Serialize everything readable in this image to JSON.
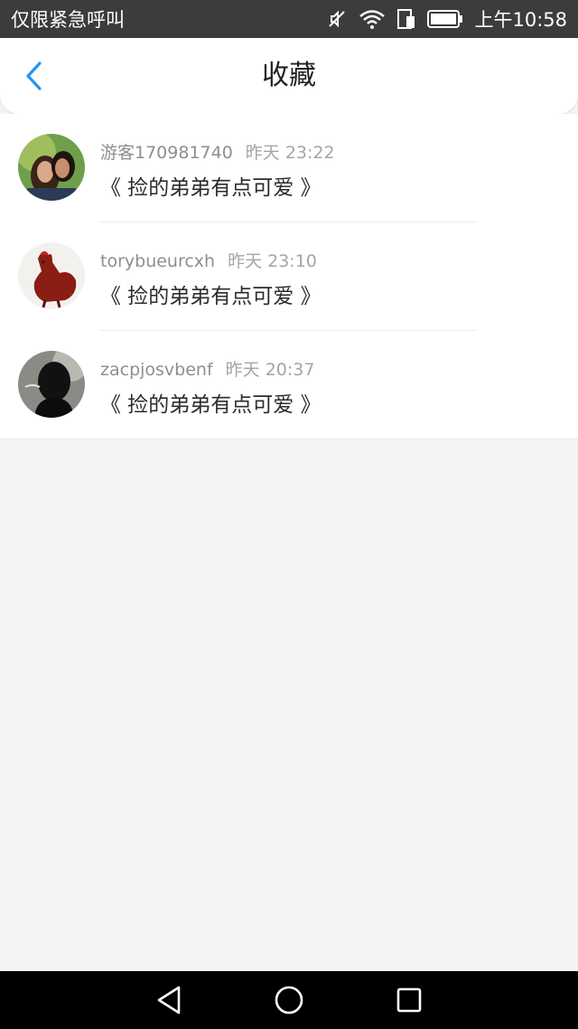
{
  "status_bar": {
    "carrier": "仅限紧急呼叫",
    "time": "上午10:58",
    "icons": [
      "mute-icon",
      "wifi-icon",
      "sim-icon",
      "battery-icon"
    ]
  },
  "header": {
    "title": "收藏",
    "back_icon": "back-chevron-icon",
    "accent_color": "#2196f3"
  },
  "favorites": [
    {
      "username": "游客170981740",
      "time": "昨天 23:22",
      "book": "《 捡的弟弟有点可爱 》",
      "avatar": "couple-photo"
    },
    {
      "username": "torybueurcxh",
      "time": "昨天 23:10",
      "book": "《 捡的弟弟有点可爱 》",
      "avatar": "red-rooster"
    },
    {
      "username": "zacpjosvbenf",
      "time": "昨天 20:37",
      "book": "《 捡的弟弟有点可爱 》",
      "avatar": "dark-figure"
    }
  ],
  "nav_bar": {
    "buttons": [
      "back-triangle-icon",
      "home-circle-icon",
      "recents-square-icon"
    ]
  }
}
